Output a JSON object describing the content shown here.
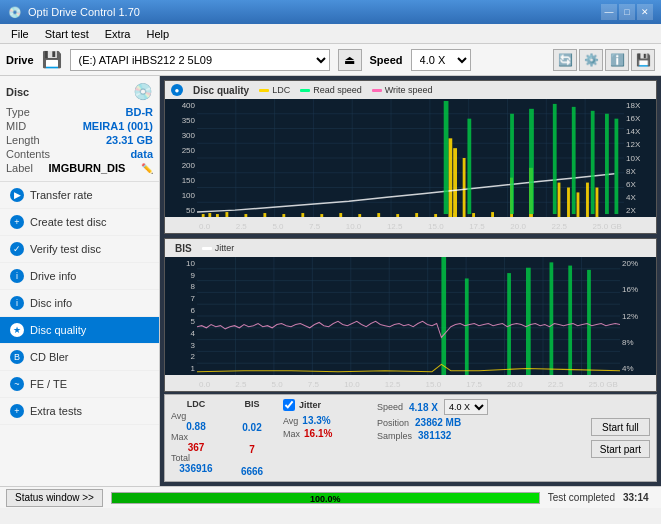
{
  "app": {
    "title": "Opti Drive Control 1.70",
    "icon": "💿"
  },
  "titlebar": {
    "minimize": "—",
    "maximize": "□",
    "close": "✕"
  },
  "menubar": {
    "items": [
      "File",
      "Start test",
      "Extra",
      "Help"
    ]
  },
  "drivebar": {
    "drive_label": "Drive",
    "drive_value": "(E:)  ATAPI iHBS212  2 5L09",
    "speed_label": "Speed",
    "speed_value": "4.0 X"
  },
  "disc": {
    "header": "Disc",
    "type_label": "Type",
    "type_value": "BD-R",
    "mid_label": "MID",
    "mid_value": "MEIRA1 (001)",
    "length_label": "Length",
    "length_value": "23.31 GB",
    "contents_label": "Contents",
    "contents_value": "data",
    "label_label": "Label",
    "label_value": "IMGBURN_DIS"
  },
  "nav": {
    "items": [
      {
        "id": "transfer-rate",
        "label": "Transfer rate",
        "active": false
      },
      {
        "id": "create-test-disc",
        "label": "Create test disc",
        "active": false
      },
      {
        "id": "verify-test-disc",
        "label": "Verify test disc",
        "active": false
      },
      {
        "id": "drive-info",
        "label": "Drive info",
        "active": false
      },
      {
        "id": "disc-info",
        "label": "Disc info",
        "active": false
      },
      {
        "id": "disc-quality",
        "label": "Disc quality",
        "active": true
      },
      {
        "id": "cd-bler",
        "label": "CD Bler",
        "active": false
      },
      {
        "id": "fe-te",
        "label": "FE / TE",
        "active": false
      },
      {
        "id": "extra-tests",
        "label": "Extra tests",
        "active": false
      }
    ]
  },
  "chart1": {
    "title": "Disc quality",
    "legend": {
      "ldc": "LDC",
      "read": "Read speed",
      "write": "Write speed"
    },
    "y_axis": {
      "left": [
        "400",
        "350",
        "300",
        "250",
        "200",
        "150",
        "100",
        "50"
      ],
      "right": [
        "18X",
        "16X",
        "14X",
        "12X",
        "10X",
        "8X",
        "6X",
        "4X",
        "2X"
      ]
    },
    "x_axis": [
      "0.0",
      "2.5",
      "5.0",
      "7.5",
      "10.0",
      "12.5",
      "15.0",
      "17.5",
      "20.0",
      "22.5",
      "25.0 GB"
    ]
  },
  "chart2": {
    "title": "BIS",
    "legend": {
      "jitter": "Jitter"
    },
    "y_axis": {
      "left": [
        "10",
        "9",
        "8",
        "7",
        "6",
        "5",
        "4",
        "3",
        "2",
        "1"
      ],
      "right": [
        "20%",
        "16%",
        "12%",
        "8%",
        "4%"
      ]
    },
    "x_axis": [
      "0.0",
      "2.5",
      "5.0",
      "7.5",
      "10.0",
      "12.5",
      "15.0",
      "17.5",
      "20.0",
      "22.5",
      "25.0 GB"
    ]
  },
  "stats": {
    "ldc_header": "LDC",
    "bis_header": "BIS",
    "jitter_header": "Jitter",
    "avg_label": "Avg",
    "max_label": "Max",
    "total_label": "Total",
    "ldc_avg": "0.88",
    "ldc_max": "367",
    "ldc_total": "336916",
    "bis_avg": "0.02",
    "bis_max": "7",
    "bis_total": "6666",
    "jitter_checked": true,
    "jitter_avg": "13.3%",
    "jitter_max": "16.1%",
    "jitter_total": "",
    "speed_label": "Speed",
    "speed_value": "4.18 X",
    "speed_select": "4.0 X",
    "position_label": "Position",
    "position_value": "23862 MB",
    "samples_label": "Samples",
    "samples_value": "381132",
    "start_full_label": "Start full",
    "start_part_label": "Start part"
  },
  "statusbar": {
    "button_label": "Status window >>",
    "progress": 100,
    "status_text": "Test completed",
    "time": "33:14"
  }
}
